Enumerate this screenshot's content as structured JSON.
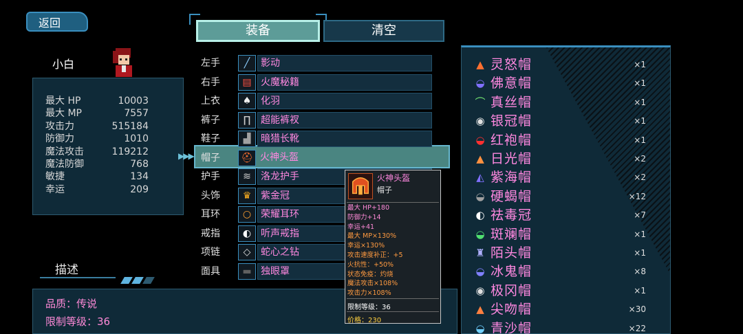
{
  "back_label": "返回",
  "character": {
    "name": "小白"
  },
  "stats": [
    {
      "label": "最大 HP",
      "value": "10003"
    },
    {
      "label": "最大 MP",
      "value": "7557"
    },
    {
      "label": "攻击力",
      "value": "515184"
    },
    {
      "label": "防御力",
      "value": "1010"
    },
    {
      "label": "魔法攻击",
      "value": "119212"
    },
    {
      "label": "魔法防御",
      "value": "768"
    },
    {
      "label": "敏捷",
      "value": "134"
    },
    {
      "label": "幸运",
      "value": "209"
    }
  ],
  "description": {
    "title": "描述",
    "quality": "品质：传说",
    "level_req": "限制等级：36"
  },
  "tabs": {
    "equip": "装备",
    "clear": "清空"
  },
  "slots": [
    {
      "slot": "左手",
      "item": "影动",
      "icon": "sword-icon",
      "glyph": "╱",
      "color": "#8fd0ff"
    },
    {
      "slot": "右手",
      "item": "火魔秘籍",
      "icon": "spellbook-icon",
      "glyph": "▤",
      "color": "#ff5040"
    },
    {
      "slot": "上衣",
      "item": "化羽",
      "icon": "armor-icon",
      "glyph": "♠",
      "color": "#f0f0f0"
    },
    {
      "slot": "裤子",
      "item": "超能裤衩",
      "icon": "pants-icon",
      "glyph": "∏",
      "color": "#d0d0d0"
    },
    {
      "slot": "鞋子",
      "item": "暗猎长靴",
      "icon": "boots-icon",
      "glyph": "▟",
      "color": "#a0a0a0"
    },
    {
      "slot": "帽子",
      "item": "火神头盔",
      "icon": "helmet-icon",
      "glyph": "⛑",
      "color": "#ff7030",
      "selected": true
    },
    {
      "slot": "护手",
      "item": "洛龙护手",
      "icon": "gauntlet-icon",
      "glyph": "≋",
      "color": "#d0d0d0"
    },
    {
      "slot": "头饰",
      "item": "紫金冠",
      "icon": "crown-icon",
      "glyph": "♛",
      "color": "#ffb020"
    },
    {
      "slot": "耳环",
      "item": "荣耀耳环",
      "icon": "earring-icon",
      "glyph": "○",
      "color": "#ffa030"
    },
    {
      "slot": "戒指",
      "item": "听声戒指",
      "icon": "ring-icon",
      "glyph": "◐",
      "color": "#ffffff"
    },
    {
      "slot": "项链",
      "item": "蛇心之钻",
      "icon": "necklace-icon",
      "glyph": "◇",
      "color": "#e0e0e0"
    },
    {
      "slot": "面具",
      "item": "独眼罩",
      "icon": "eyepatch-icon",
      "glyph": "▬",
      "color": "#606060"
    }
  ],
  "tooltip": {
    "name": "火神头盔",
    "type": "帽子",
    "stats_a": [
      "最大 HP+180",
      "防御力+14",
      "幸运+41"
    ],
    "stats_b": [
      "最大 MP×130%",
      "幸运×130%",
      "攻击速度补正：+5",
      "火抗性：+50%",
      "状态免疫：灼烧",
      "魔法攻击×108%",
      "攻击力×108%"
    ],
    "level": "限制等级：36",
    "price": "价格：230"
  },
  "inventory": [
    {
      "name": "灵怒帽",
      "qty": "×1",
      "icon": "hat-icon",
      "glyph": "▲",
      "color": "#ff7030"
    },
    {
      "name": "佛意帽",
      "qty": "×1",
      "icon": "hat-icon",
      "glyph": "◒",
      "color": "#8070ff"
    },
    {
      "name": "真丝帽",
      "qty": "×1",
      "icon": "hat-icon",
      "glyph": "⌒",
      "color": "#70e070"
    },
    {
      "name": "银冠帽",
      "qty": "×1",
      "icon": "hat-icon",
      "glyph": "◉",
      "color": "#e0e0e0"
    },
    {
      "name": "红袍帽",
      "qty": "×1",
      "icon": "hat-icon",
      "glyph": "◒",
      "color": "#ff3030"
    },
    {
      "name": "日光帽",
      "qty": "×2",
      "icon": "hat-icon",
      "glyph": "▲",
      "color": "#ff9040"
    },
    {
      "name": "紫海帽",
      "qty": "×2",
      "icon": "hat-icon",
      "glyph": "◭",
      "color": "#8070ff"
    },
    {
      "name": "硬蝎帽",
      "qty": "×12",
      "icon": "hat-icon",
      "glyph": "◒",
      "color": "#a0a0a0"
    },
    {
      "name": "祛毒冠",
      "qty": "×7",
      "icon": "hat-icon",
      "glyph": "◐",
      "color": "#ffffff"
    },
    {
      "name": "斑斓帽",
      "qty": "×1",
      "icon": "hat-icon",
      "glyph": "◒",
      "color": "#50e070"
    },
    {
      "name": "陌头帽",
      "qty": "×1",
      "icon": "hat-icon",
      "glyph": "♜",
      "color": "#b0b0ff"
    },
    {
      "name": "冰鬼帽",
      "qty": "×8",
      "icon": "hat-icon",
      "glyph": "◒",
      "color": "#8080ff"
    },
    {
      "name": "极冈帽",
      "qty": "×1",
      "icon": "hat-icon",
      "glyph": "◉",
      "color": "#e0e0e0"
    },
    {
      "name": "尖吻帽",
      "qty": "×30",
      "icon": "hat-icon",
      "glyph": "▲",
      "color": "#ff8040"
    },
    {
      "name": "青沙帽",
      "qty": "×22",
      "icon": "hat-icon",
      "glyph": "◒",
      "color": "#70d0ff"
    }
  ],
  "colors": {
    "accent": "#3a8fbf",
    "panel": "#0f2a38",
    "item_name": "#ff88e0",
    "selected": "#4e8d88"
  }
}
